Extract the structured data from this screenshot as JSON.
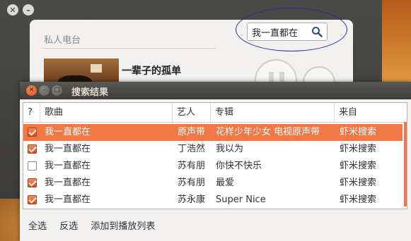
{
  "player": {
    "section_title": "私人电台",
    "search": {
      "value": "我一直都在"
    },
    "now_playing_title": "一辈子的孤单"
  },
  "dialog": {
    "title": "搜索结果",
    "columns": [
      "?",
      "歌曲",
      "艺人",
      "专辑",
      "来自"
    ],
    "rows": [
      {
        "checked": true,
        "song": "我一直都在",
        "artist": "原声带",
        "album": "花样少年少女 电视原声带",
        "source": "虾米搜索",
        "selected": true
      },
      {
        "checked": true,
        "song": "我一直都在",
        "artist": "丁浩然",
        "album": "我以为",
        "source": "虾米搜索",
        "selected": false
      },
      {
        "checked": false,
        "song": "我一直都在",
        "artist": "苏有朋",
        "album": "你快不快乐",
        "source": "虾米搜索",
        "selected": false
      },
      {
        "checked": true,
        "song": "我一直都在",
        "artist": "苏有朋",
        "album": "最爱",
        "source": "虾米搜索",
        "selected": false
      },
      {
        "checked": true,
        "song": "我一直都在",
        "artist": "苏永康",
        "album": "Super Nice",
        "source": "虾米搜索",
        "selected": false
      }
    ],
    "footer": {
      "select_all": "全选",
      "invert": "反选",
      "add_to_playlist": "添加到播放列表"
    }
  },
  "colors": {
    "accent": "#f07746",
    "titlebar": "#3c3b37",
    "annotation": "#2a2f9a"
  }
}
